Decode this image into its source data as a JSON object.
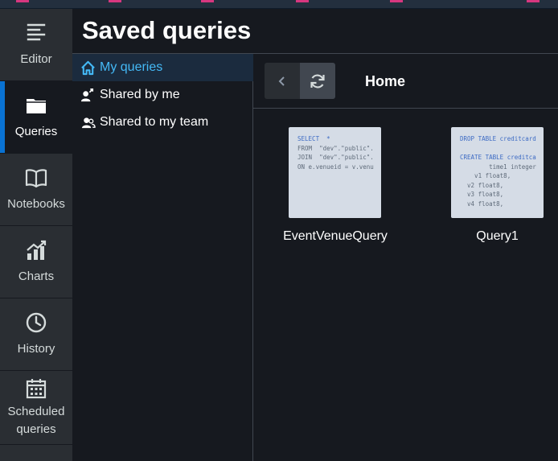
{
  "header": {
    "title": "Saved queries"
  },
  "rail": {
    "items": [
      {
        "label": "Editor",
        "icon": "editor-icon"
      },
      {
        "label": "Queries",
        "icon": "folder-icon",
        "active": true
      },
      {
        "label": "Notebooks",
        "icon": "book-icon"
      },
      {
        "label": "Charts",
        "icon": "chart-icon"
      },
      {
        "label": "History",
        "icon": "clock-icon"
      },
      {
        "label": "Scheduled queries",
        "line1": "Scheduled",
        "line2": "queries",
        "icon": "calendar-icon"
      }
    ]
  },
  "folders": {
    "items": [
      {
        "label": "My queries",
        "icon": "home-icon",
        "selected": true
      },
      {
        "label": "Shared by me",
        "icon": "user-share-icon"
      },
      {
        "label": "Shared to my team",
        "icon": "users-icon"
      }
    ]
  },
  "toolbar": {
    "breadcrumb": "Home",
    "back_icon": "chevron-left-icon",
    "refresh_icon": "refresh-icon"
  },
  "queries": [
    {
      "name": "EventVenueQuery",
      "preview": [
        "SELECT  *",
        "FROM  \"dev\".\"public\".",
        "JOIN  \"dev\".\"public\".",
        "ON e.venueid = v.venu"
      ]
    },
    {
      "name": "Query1",
      "preview": [
        "DROP TABLE creditcard",
        "",
        "CREATE TABLE creditca",
        "        time1 integer",
        "    v1 float8,",
        "  v2 float8,",
        "  v3 float8,",
        "  v4 float8,"
      ]
    }
  ],
  "colors": {
    "accent": "#0972d3",
    "selected_text": "#44b9f6",
    "background": "#16191f",
    "rail": "#2a2e33"
  }
}
